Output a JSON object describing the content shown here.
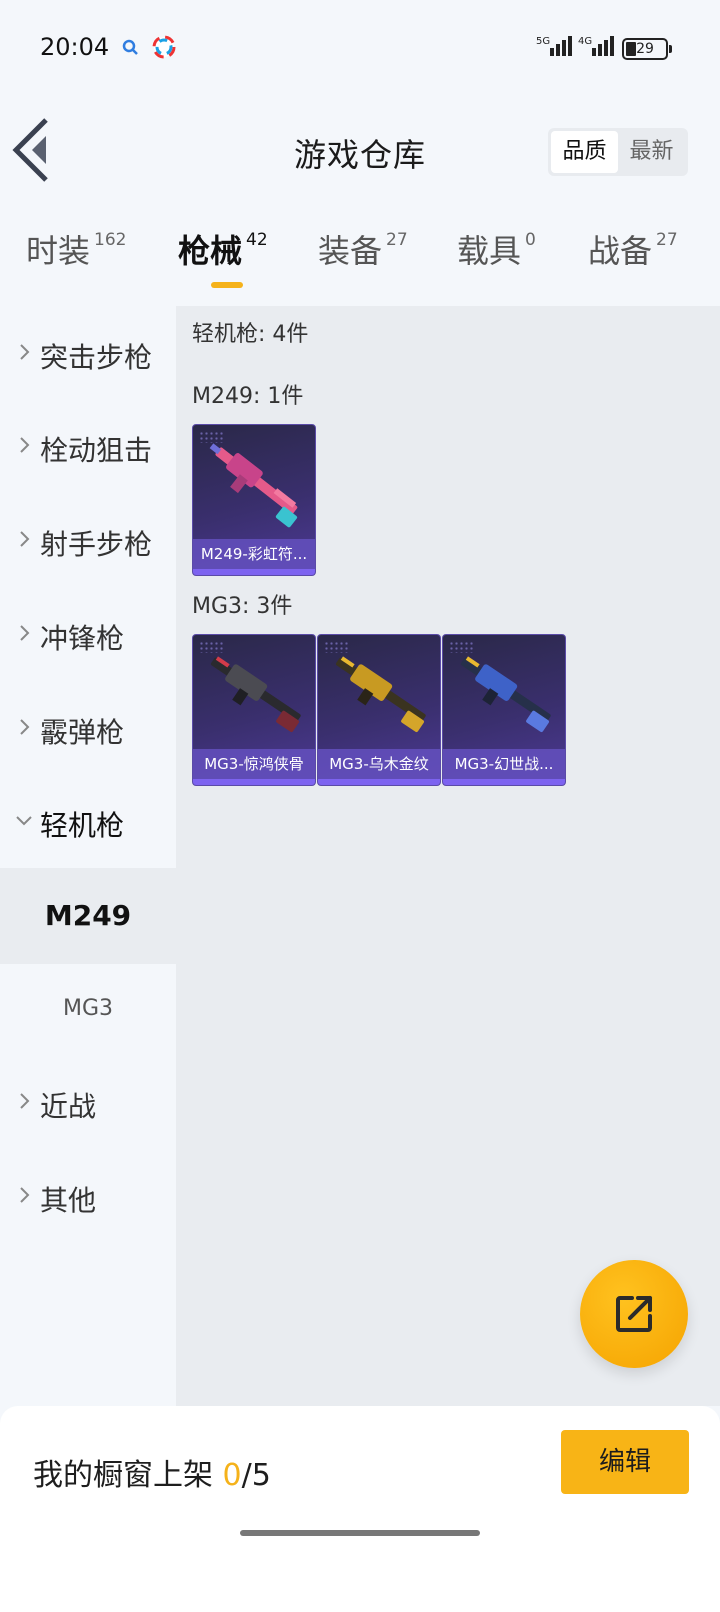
{
  "status_bar": {
    "time": "20:04",
    "network1": "5G",
    "network2": "4G",
    "battery": "29"
  },
  "header": {
    "title": "游戏仓库",
    "sort_options": [
      "品质",
      "最新"
    ],
    "active_sort": "品质"
  },
  "tabs": [
    {
      "label": "时装",
      "count": "162"
    },
    {
      "label": "枪械",
      "count": "42"
    },
    {
      "label": "装备",
      "count": "27"
    },
    {
      "label": "载具",
      "count": "0"
    },
    {
      "label": "战备",
      "count": "27"
    }
  ],
  "active_tab": "枪械",
  "sidebar": {
    "items": [
      {
        "label": "突击步枪"
      },
      {
        "label": "栓动狙击"
      },
      {
        "label": "射手步枪"
      },
      {
        "label": "冲锋枪"
      },
      {
        "label": "霰弹枪"
      },
      {
        "label": "轻机枪"
      },
      {
        "label": "近战"
      },
      {
        "label": "其他"
      }
    ],
    "expanded": "轻机枪",
    "sub_items": [
      {
        "label": "M249"
      },
      {
        "label": "MG3"
      }
    ],
    "active_sub": "M249"
  },
  "content": {
    "category_title": "轻机枪: 4件",
    "groups": [
      {
        "title": "M249: 1件",
        "items": [
          {
            "name": "M249-彩虹符..."
          }
        ]
      },
      {
        "title": "MG3: 3件",
        "items": [
          {
            "name": "MG3-惊鸿侠骨"
          },
          {
            "name": "MG3-乌木金纹"
          },
          {
            "name": "MG3-幻世战..."
          }
        ]
      }
    ]
  },
  "bottom": {
    "shelf_label": "我的橱窗上架",
    "shelf_current": "0",
    "shelf_total": "/5",
    "edit_label": "编辑"
  },
  "colors": {
    "accent": "#f5b21a",
    "card_bg": "#3a2f6e",
    "card_name_bar": "#6450be"
  },
  "icons": {
    "back": "back-arrow-icon",
    "fab": "share-external-icon"
  }
}
